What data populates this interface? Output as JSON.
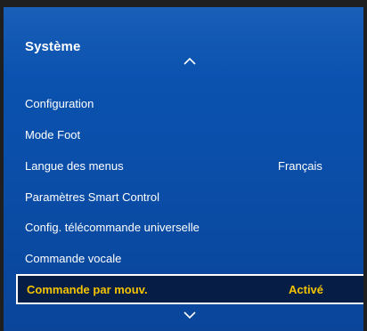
{
  "menu": {
    "title": "Système",
    "items": [
      {
        "label": "Configuration",
        "value": ""
      },
      {
        "label": "Mode Foot",
        "value": ""
      },
      {
        "label": "Langue des menus",
        "value": "Français"
      },
      {
        "label": "Paramètres Smart Control",
        "value": ""
      },
      {
        "label": "Config. télécommande universelle",
        "value": ""
      },
      {
        "label": "Commande vocale",
        "value": ""
      },
      {
        "label": "Commande par mouv.",
        "value": "Activé"
      }
    ]
  },
  "colors": {
    "panel": "#0b55b3",
    "selected_bg": "#061d46",
    "selected_text": "#f5c400",
    "text": "#ffffff"
  },
  "icons": {
    "scroll_up": "chevron-up-icon",
    "scroll_down": "chevron-down-icon"
  }
}
